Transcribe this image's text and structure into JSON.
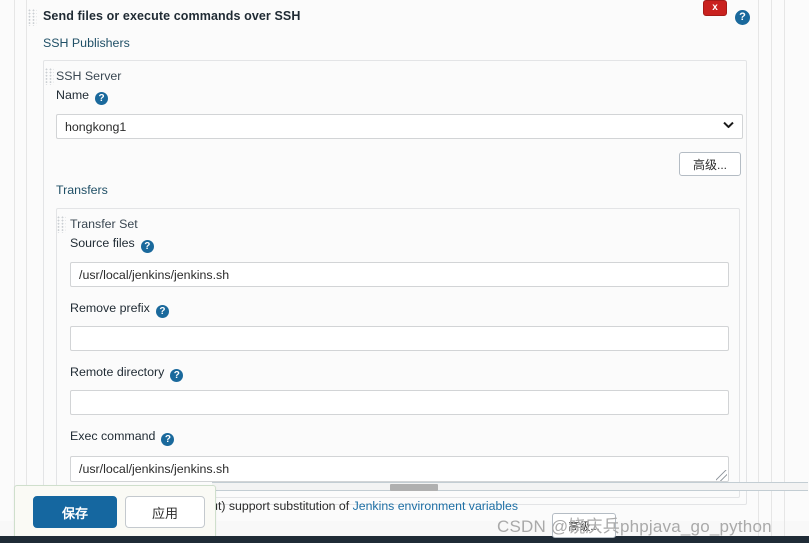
{
  "window": {
    "close_label": "x",
    "help_label": "?"
  },
  "section": {
    "title": "Send files or execute commands over SSH",
    "subtitle": "SSH Publishers",
    "grip_icon": "drag-handle-icon"
  },
  "ssh_server": {
    "legend": "SSH Server",
    "name_label": "Name",
    "help_label": "?",
    "selected": "hongkong1",
    "options": [
      "hongkong1"
    ],
    "advanced_label": "高级..."
  },
  "transfers": {
    "legend": "Transfers",
    "transfer_set_legend": "Transfer Set",
    "fields": [
      {
        "label": "Source files",
        "help": "?",
        "value": "/usr/local/jenkins/jenkins.sh",
        "placeholder": ""
      },
      {
        "label": "Remove prefix",
        "help": "?",
        "value": "",
        "placeholder": ""
      },
      {
        "label": "Remote directory",
        "help": "?",
        "value": "",
        "placeholder": ""
      },
      {
        "label": "Exec command",
        "help": "?",
        "value": "/usr/local/jenkins/jenkins.sh",
        "placeholder": ""
      }
    ]
  },
  "note": {
    "text_before": "ept for Exec timeout) support substitution of ",
    "link_text": "Jenkins environment variables"
  },
  "action_bar": {
    "save_label": "保存",
    "apply_label": "应用"
  },
  "ghost_button": {
    "label": "高级..."
  },
  "watermark": {
    "text": "CSDN @饶庆兵phpjava_go_python"
  },
  "colors": {
    "accent_blue": "#1567a0",
    "help_blue": "#1a699c",
    "close_red": "#c9211e",
    "link_blue": "#1d6fa5",
    "panel_border": "#e3e4e6"
  }
}
